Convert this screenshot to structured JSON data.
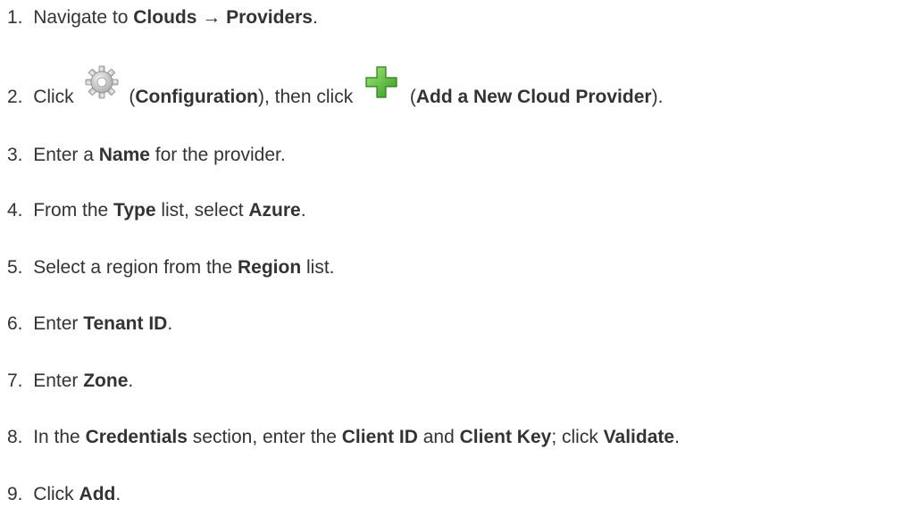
{
  "steps": [
    {
      "num": "1.",
      "parts": [
        {
          "t": "Navigate to ",
          "b": false
        },
        {
          "t": "Clouds",
          "b": true
        },
        {
          "t": " → ",
          "b": false
        },
        {
          "t": "Providers",
          "b": true
        },
        {
          "t": ".",
          "b": false
        }
      ]
    },
    {
      "num": "2.",
      "parts": [
        {
          "t": "Click ",
          "b": false
        },
        {
          "icon": "gear-icon"
        },
        {
          "t": " (",
          "b": false
        },
        {
          "t": "Configuration",
          "b": true
        },
        {
          "t": "), then click ",
          "b": false
        },
        {
          "icon": "add-plus-icon"
        },
        {
          "t": " (",
          "b": false
        },
        {
          "t": "Add a New Cloud Provider",
          "b": true
        },
        {
          "t": ").",
          "b": false
        }
      ]
    },
    {
      "num": "3.",
      "parts": [
        {
          "t": "Enter a ",
          "b": false
        },
        {
          "t": "Name",
          "b": true
        },
        {
          "t": " for the provider.",
          "b": false
        }
      ]
    },
    {
      "num": "4.",
      "parts": [
        {
          "t": "From the ",
          "b": false
        },
        {
          "t": "Type",
          "b": true
        },
        {
          "t": " list, select ",
          "b": false
        },
        {
          "t": "Azure",
          "b": true
        },
        {
          "t": ".",
          "b": false
        }
      ]
    },
    {
      "num": "5.",
      "parts": [
        {
          "t": "Select a region from the ",
          "b": false
        },
        {
          "t": "Region",
          "b": true
        },
        {
          "t": " list.",
          "b": false
        }
      ]
    },
    {
      "num": "6.",
      "parts": [
        {
          "t": "Enter ",
          "b": false
        },
        {
          "t": "Tenant ID",
          "b": true
        },
        {
          "t": ".",
          "b": false
        }
      ]
    },
    {
      "num": "7.",
      "parts": [
        {
          "t": "Enter ",
          "b": false
        },
        {
          "t": "Zone",
          "b": true
        },
        {
          "t": ".",
          "b": false
        }
      ]
    },
    {
      "num": "8.",
      "parts": [
        {
          "t": "In the ",
          "b": false
        },
        {
          "t": "Credentials",
          "b": true
        },
        {
          "t": " section, enter the ",
          "b": false
        },
        {
          "t": "Client ID",
          "b": true
        },
        {
          "t": " and ",
          "b": false
        },
        {
          "t": "Client Key",
          "b": true
        },
        {
          "t": "; click ",
          "b": false
        },
        {
          "t": "Validate",
          "b": true
        },
        {
          "t": ".",
          "b": false
        }
      ]
    },
    {
      "num": "9.",
      "parts": [
        {
          "t": "Click ",
          "b": false
        },
        {
          "t": "Add",
          "b": true
        },
        {
          "t": ".",
          "b": false
        }
      ]
    }
  ]
}
